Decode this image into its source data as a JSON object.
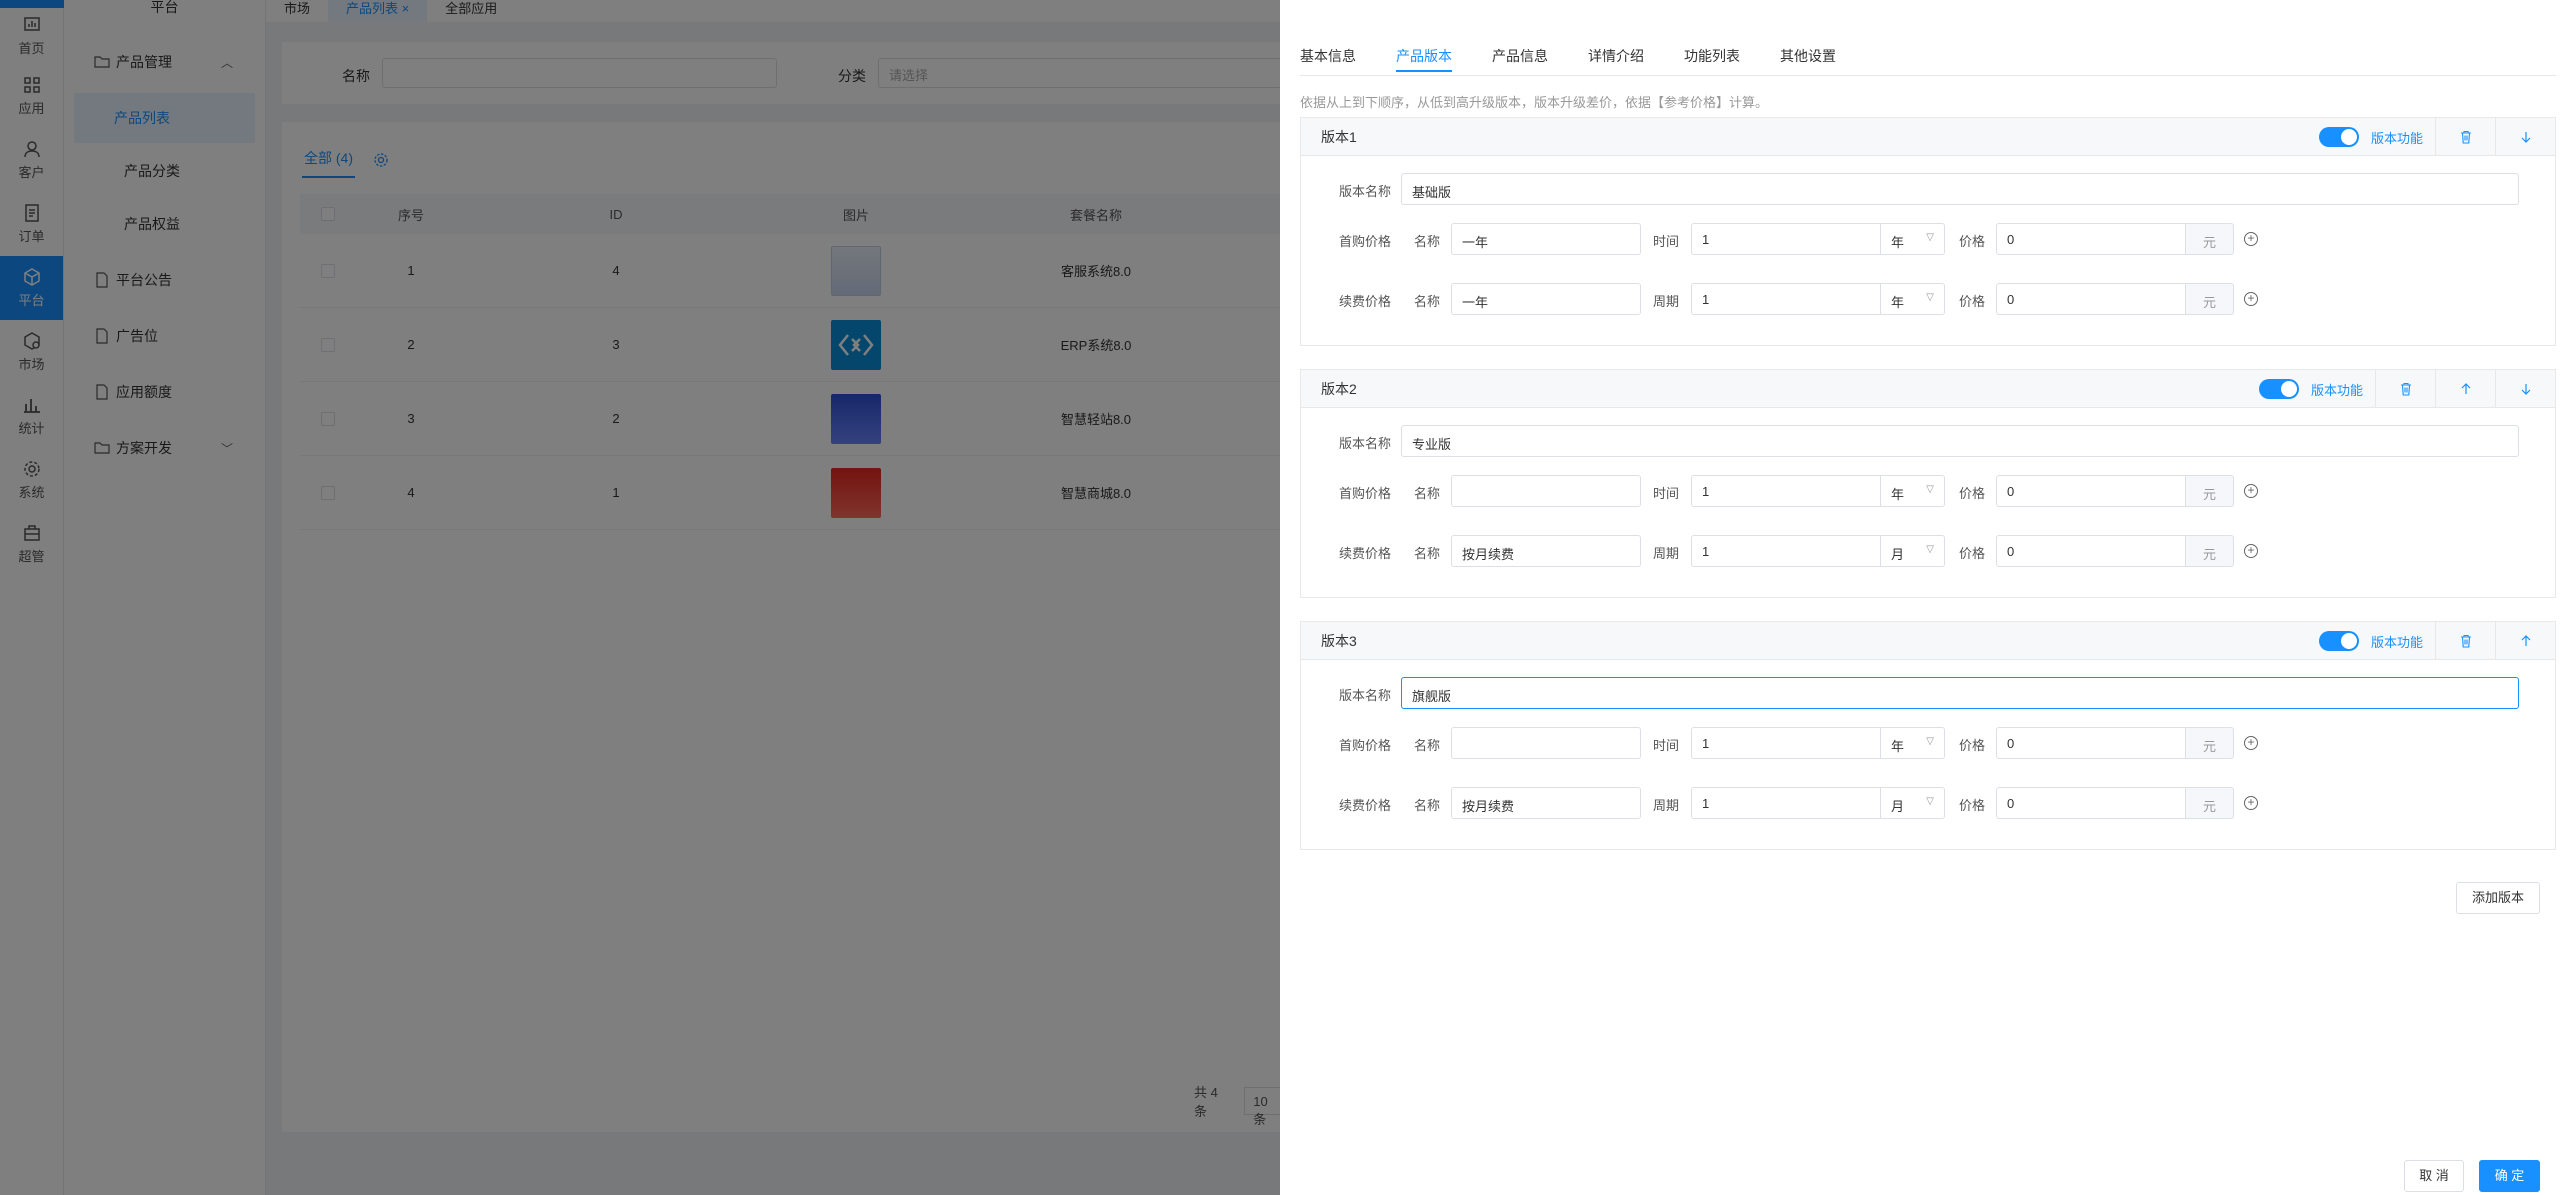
{
  "rail": {
    "items": [
      {
        "label": "首页",
        "icon": "dashboard-icon"
      },
      {
        "label": "应用",
        "icon": "apps-icon"
      },
      {
        "label": "客户",
        "icon": "user-icon"
      },
      {
        "label": "订单",
        "icon": "order-icon"
      },
      {
        "label": "平台",
        "icon": "cube-icon"
      },
      {
        "label": "市场",
        "icon": "market-icon"
      },
      {
        "label": "统计",
        "icon": "bar-chart-icon"
      },
      {
        "label": "系统",
        "icon": "gear-icon"
      },
      {
        "label": "超管",
        "icon": "briefcase-icon"
      }
    ]
  },
  "sidebar": {
    "title": "平台",
    "items": [
      {
        "label": "产品管理"
      },
      {
        "label": "产品列表"
      },
      {
        "label": "产品分类"
      },
      {
        "label": "产品权益"
      },
      {
        "label": "平台公告"
      },
      {
        "label": "广告位"
      },
      {
        "label": "应用额度"
      },
      {
        "label": "方案开发"
      }
    ]
  },
  "tabs": [
    {
      "label": "市场"
    },
    {
      "label": "产品列表 ×"
    },
    {
      "label": "全部应用"
    }
  ],
  "filter": {
    "name_label": "名称",
    "category_label": "分类",
    "category_placeholder": "请选择"
  },
  "table": {
    "tab_all": "全部 (4)",
    "headers": [
      "序号",
      "ID",
      "图片",
      "套餐名称"
    ],
    "rows": [
      {
        "seq": "1",
        "id": "4",
        "name": "客服系统8.0"
      },
      {
        "seq": "2",
        "id": "3",
        "name": "ERP系统8.0"
      },
      {
        "seq": "3",
        "id": "2",
        "name": "智慧轻站8.0"
      },
      {
        "seq": "4",
        "id": "1",
        "name": "智慧商城8.0"
      }
    ],
    "total": "共 4 条",
    "page_size": "10条"
  },
  "drawer": {
    "tabs": [
      "基本信息",
      "产品版本",
      "产品信息",
      "详情介绍",
      "功能列表",
      "其他设置"
    ],
    "hint": "依据从上到下顺序，从低到高升级版本，版本升级差价，依据【参考价格】计算。",
    "labels": {
      "version_name": "版本名称",
      "first_price": "首购价格",
      "renew_price": "续费价格",
      "name": "名称",
      "time": "时间",
      "period": "周期",
      "price": "价格",
      "yuan": "元",
      "version_func": "版本功能"
    },
    "versions": [
      {
        "title": "版本1",
        "name": "基础版",
        "first": {
          "name": "一年",
          "time": "1",
          "unit": "年",
          "price": "0"
        },
        "renew": {
          "name": "一年",
          "period": "1",
          "unit": "年",
          "price": "0"
        }
      },
      {
        "title": "版本2",
        "name": "专业版",
        "first": {
          "name": "",
          "time": "1",
          "unit": "年",
          "price": "0"
        },
        "renew": {
          "name": "按月续费",
          "period": "1",
          "unit": "月",
          "price": "0"
        }
      },
      {
        "title": "版本3",
        "name": "旗舰版",
        "first": {
          "name": "",
          "time": "1",
          "unit": "年",
          "price": "0"
        },
        "renew": {
          "name": "按月续费",
          "period": "1",
          "unit": "月",
          "price": "0"
        }
      }
    ],
    "add_version": "添加版本",
    "cancel": "取 消",
    "confirm": "确 定"
  }
}
